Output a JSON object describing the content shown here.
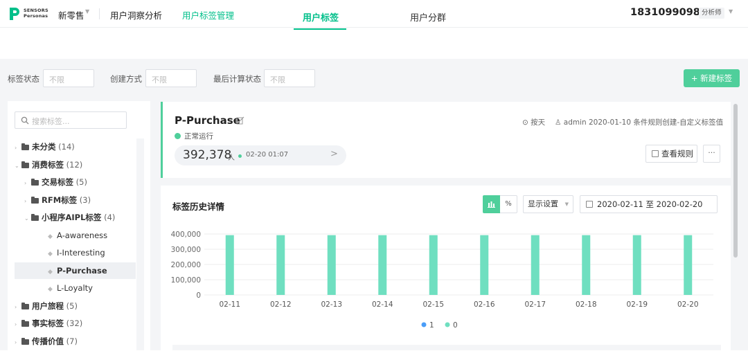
{
  "app": {
    "logo_line1": "SENSORS",
    "logo_line2": "Personas",
    "project": "新零售",
    "nav": [
      "用户洞察分析",
      "用户标签管理"
    ],
    "user": "18310990988",
    "role": "分析师",
    "brand_color": "#00bf8a"
  },
  "tabs": [
    {
      "label": "用户标签",
      "active": true
    },
    {
      "label": "用户分群",
      "active": false
    }
  ],
  "filters": [
    {
      "label": "标签状态",
      "placeholder": "不限"
    },
    {
      "label": "创建方式",
      "placeholder": "不限"
    },
    {
      "label": "最后计算状态",
      "placeholder": "不限"
    }
  ],
  "new_button": "+ 新建标签",
  "sidebar": {
    "search_placeholder": "搜索标签...",
    "tree": [
      {
        "label": "未分类",
        "count": "(14)",
        "level": 0,
        "type": "folder",
        "caret": "›"
      },
      {
        "label": "消费标签",
        "count": "(12)",
        "level": 0,
        "type": "folder",
        "caret": "⌄"
      },
      {
        "label": "交易标签",
        "count": "(5)",
        "level": 1,
        "type": "folder",
        "caret": "›"
      },
      {
        "label": "RFM标签",
        "count": "(3)",
        "level": 1,
        "type": "folder",
        "caret": "›"
      },
      {
        "label": "小程序AIPL标签",
        "count": "(4)",
        "level": 1,
        "type": "folder",
        "caret": "⌄"
      },
      {
        "label": "A-awareness",
        "count": "",
        "level": 2,
        "type": "tag"
      },
      {
        "label": "I-Interesting",
        "count": "",
        "level": 2,
        "type": "tag"
      },
      {
        "label": "P-Purchase",
        "count": "",
        "level": 2,
        "type": "tag",
        "selected": true
      },
      {
        "label": "L-Loyalty",
        "count": "",
        "level": 2,
        "type": "tag"
      },
      {
        "label": "用户旅程",
        "count": "(5)",
        "level": 0,
        "type": "folder",
        "caret": "›"
      },
      {
        "label": "事实标签",
        "count": "(32)",
        "level": 0,
        "type": "folder",
        "caret": "›"
      },
      {
        "label": "传播价值",
        "count": "(7)",
        "level": 0,
        "type": "folder",
        "caret": "›"
      }
    ]
  },
  "tag_card": {
    "title": "P-Purchase",
    "status": "正常运行",
    "count": "392,378",
    "unit": "人",
    "time": "02-20 01:07",
    "frequency": "按天",
    "meta": "admin 2020-01-10 条件规则创建-自定义标签值",
    "rule_button": "查看规则",
    "more_button": "···"
  },
  "history": {
    "title": "标签历史详情",
    "percent_toggle": "%",
    "display_settings": "显示设置",
    "date_range": "2020-02-11 至 2020-02-20"
  },
  "chart_data": {
    "type": "bar",
    "categories": [
      "02-11",
      "02-12",
      "02-13",
      "02-14",
      "02-15",
      "02-16",
      "02-17",
      "02-18",
      "02-19",
      "02-20"
    ],
    "series": [
      {
        "name": "1",
        "values": [
          0,
          0,
          0,
          0,
          0,
          0,
          0,
          0,
          0,
          0
        ],
        "color": "#4a9df8"
      },
      {
        "name": "0",
        "values": [
          392378,
          392378,
          392378,
          392378,
          392378,
          392378,
          392378,
          392378,
          392378,
          392378
        ],
        "color": "#6fdfc0"
      }
    ],
    "yticks": [
      "400,000",
      "300,000",
      "200,000",
      "100,000",
      "0"
    ],
    "ylim": [
      0,
      400000
    ],
    "legend_position": "bottom"
  }
}
